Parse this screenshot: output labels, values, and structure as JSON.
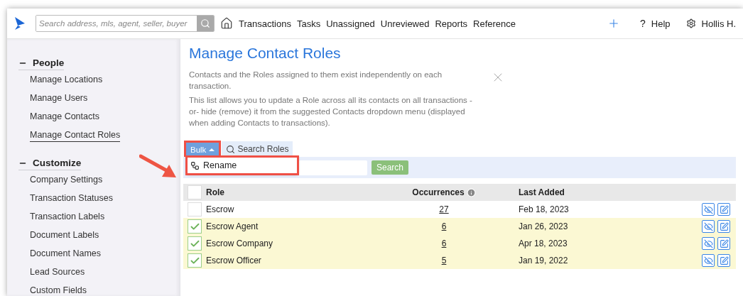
{
  "topbar": {
    "search": {
      "placeholder": "Search address, mls, agent, seller, buyer"
    },
    "nav": [
      "Transactions",
      "Tasks",
      "Unassigned",
      "Unreviewed",
      "Reports",
      "Reference"
    ],
    "help_icon": "?",
    "help": "Help",
    "user": "Hollis H."
  },
  "sidebar": {
    "sections": [
      {
        "title": "People",
        "expanded": true,
        "items": [
          {
            "label": "Manage Locations",
            "selected": false
          },
          {
            "label": "Manage Users",
            "selected": false
          },
          {
            "label": "Manage Contacts",
            "selected": false
          },
          {
            "label": "Manage Contact Roles",
            "selected": true
          }
        ]
      },
      {
        "title": "Customize",
        "expanded": true,
        "items": [
          {
            "label": "Company Settings",
            "selected": false
          },
          {
            "label": "Transaction Statuses",
            "selected": false
          },
          {
            "label": "Transaction Labels",
            "selected": false
          },
          {
            "label": "Document Labels",
            "selected": false
          },
          {
            "label": "Document Names",
            "selected": false
          },
          {
            "label": "Lead Sources",
            "selected": false
          },
          {
            "label": "Custom Fields",
            "selected": false
          }
        ]
      }
    ]
  },
  "page": {
    "title": "Manage Contact Roles",
    "info": [
      "Contacts and the Roles assigned to them exist independently on each transaction.",
      "This list allows you to update a Role across all its contacts on all transactions -or- hide (remove) it from the suggested Contacts dropdown menu (displayed when adding Contacts to transactions)."
    ]
  },
  "toolbar": {
    "bulk": {
      "label": "Bulk",
      "expanded": true,
      "annotated": true
    },
    "search_tab": "Search Roles",
    "menu": [
      {
        "label": "Rename",
        "annotated": true
      }
    ],
    "search_button": "Search"
  },
  "table": {
    "columns": [
      "Role",
      "Occurrences",
      "Last Added"
    ],
    "all_checked": false,
    "rows": [
      {
        "role": "Escrow",
        "occurrences": "27",
        "last_added": "Feb 18, 2023",
        "checked": false
      },
      {
        "role": "Escrow Agent",
        "occurrences": "6",
        "last_added": "Jan 26, 2023",
        "checked": true
      },
      {
        "role": "Escrow Company",
        "occurrences": "6",
        "last_added": "Apr 18, 2023",
        "checked": true
      },
      {
        "role": "Escrow Officer",
        "occurrences": "5",
        "last_added": "Jan 19, 2022",
        "checked": true
      }
    ]
  }
}
